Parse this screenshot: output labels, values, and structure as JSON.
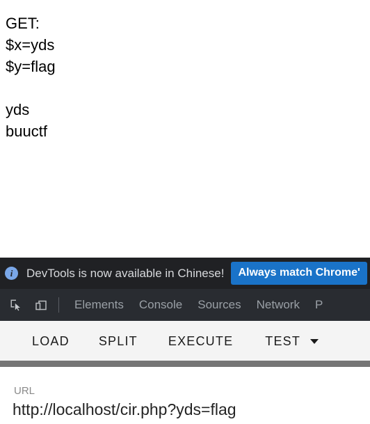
{
  "page": {
    "output_lines": [
      "GET:",
      "$x=yds",
      "$y=flag",
      "",
      "yds",
      "buuctf"
    ],
    "output_text": "GET:\n$x=yds\n$y=flag\n\nyds\nbuuctf"
  },
  "devtools_banner": {
    "info_icon_glyph": "i",
    "message": "DevTools is now available in Chinese!",
    "button_label": "Always match Chrome'",
    "button_color": "#1a73c8",
    "background_color": "#202124",
    "icon_color": "#7aa7e8"
  },
  "devtools_tabs": {
    "background_color": "#292c31",
    "inspect_icon_name": "inspect-element-icon",
    "device_icon_name": "device-toolbar-icon",
    "items": [
      {
        "label": "Elements"
      },
      {
        "label": "Console"
      },
      {
        "label": "Sources"
      },
      {
        "label": "Network"
      },
      {
        "label": "P"
      }
    ]
  },
  "action_toolbar": {
    "background_color": "#f4f4f4",
    "buttons": [
      {
        "label": "LOAD"
      },
      {
        "label": "SPLIT"
      },
      {
        "label": "EXECUTE"
      },
      {
        "label": "TEST"
      }
    ],
    "dropdown_icon": "caret-down-icon"
  },
  "separator": {
    "color": "#757575"
  },
  "url_panel": {
    "label": "URL",
    "value": "http://localhost/cir.php?yds=flag"
  }
}
